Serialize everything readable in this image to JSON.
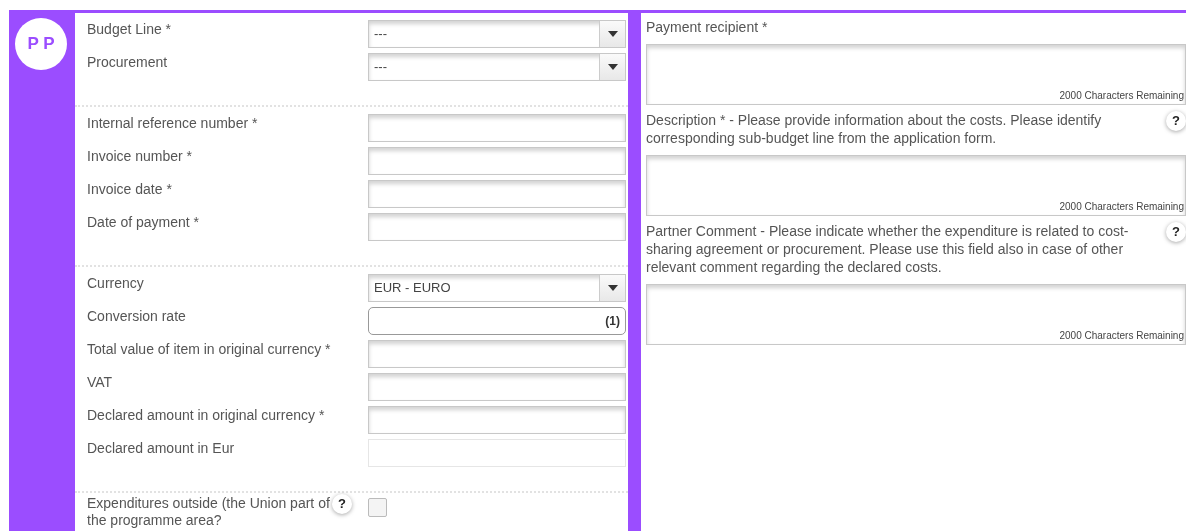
{
  "avatar": {
    "initials": "P P"
  },
  "sections": [
    {
      "fields": [
        {
          "kind": "select",
          "label": "Budget Line *",
          "value": "---"
        },
        {
          "kind": "select",
          "label": "Procurement",
          "value": "---"
        }
      ]
    },
    {
      "fields": [
        {
          "kind": "input",
          "label": "Internal reference number *"
        },
        {
          "kind": "input",
          "label": "Invoice number *"
        },
        {
          "kind": "input",
          "label": "Invoice date *"
        },
        {
          "kind": "input",
          "label": "Date of payment *"
        }
      ]
    },
    {
      "fields": [
        {
          "kind": "select",
          "label": "Currency",
          "value": "EUR - EURO"
        },
        {
          "kind": "rate",
          "label": "Conversion rate",
          "suffix": "(1)"
        },
        {
          "kind": "input",
          "label": "Total value of item in original currency *"
        },
        {
          "kind": "input",
          "label": "VAT"
        },
        {
          "kind": "input",
          "label": "Declared amount in original currency *"
        },
        {
          "kind": "readonly",
          "label": "Declared amount in Eur"
        }
      ]
    },
    {
      "fields": [
        {
          "kind": "checkbox",
          "label": "Expenditures outside (the Union part of the programme area?",
          "help": "?",
          "checked": false
        }
      ]
    }
  ],
  "text_areas": [
    {
      "label": "Payment recipient *",
      "counter": "2000 Characters Remaining"
    },
    {
      "label": "Description * - Please provide information about the costs. Please identify corresponding sub-budget line from the application form.",
      "help": "?",
      "counter": "2000 Characters Remaining"
    },
    {
      "label": "Partner Comment - Please indicate whether the expenditure is related to cost-sharing agreement or procurement. Please use this field also in case of other relevant comment regarding the declared costs.",
      "help": "?",
      "counter": "2000 Characters Remaining"
    }
  ]
}
